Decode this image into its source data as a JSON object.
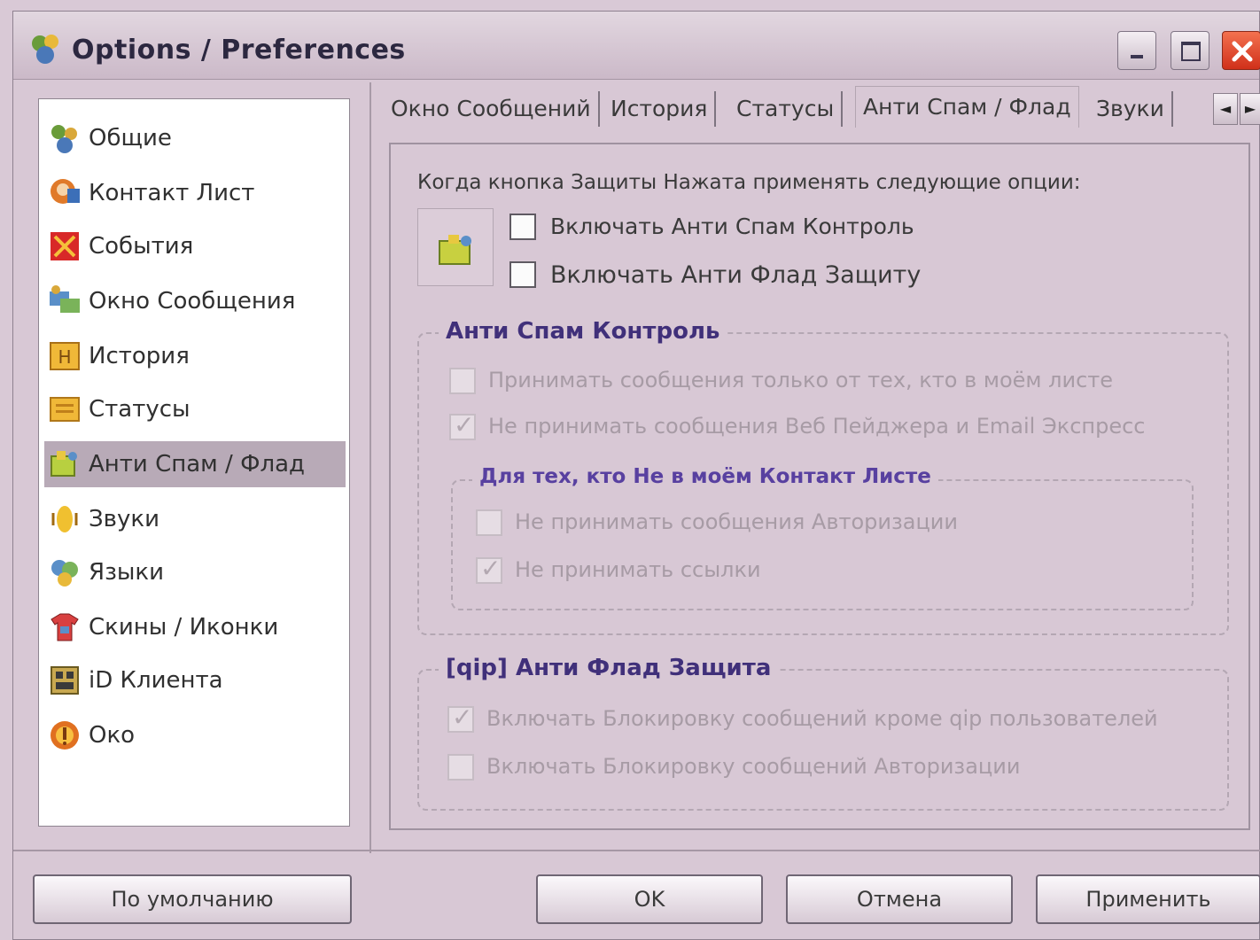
{
  "window": {
    "title": "Options / Preferences",
    "controls": [
      "minimize-icon",
      "maximize-icon",
      "close-icon"
    ]
  },
  "sidebar": {
    "selected_index": 6,
    "items": [
      {
        "label": "Общие",
        "icon": "general-icon"
      },
      {
        "label": "Контакт Лист",
        "icon": "contact-list-icon"
      },
      {
        "label": "События",
        "icon": "events-icon"
      },
      {
        "label": "Окно Сообщения",
        "icon": "message-window-icon"
      },
      {
        "label": "История",
        "icon": "history-icon"
      },
      {
        "label": "Статусы",
        "icon": "statuses-icon"
      },
      {
        "label": "Анти Спам / Флад",
        "icon": "anti-spam-icon"
      },
      {
        "label": "Звуки",
        "icon": "sounds-icon"
      },
      {
        "label": "Языки",
        "icon": "languages-icon"
      },
      {
        "label": "Скины / Иконки",
        "icon": "skins-icon"
      },
      {
        "label": "iD Клиента",
        "icon": "client-id-icon"
      },
      {
        "label": "Око",
        "icon": "eye-icon"
      }
    ]
  },
  "tabs": [
    {
      "label": "Окно Сообщений",
      "active": false
    },
    {
      "label": "История",
      "active": false
    },
    {
      "label": "Статусы",
      "active": false
    },
    {
      "label": "Анти Спам / Флад",
      "active": true
    },
    {
      "label": "Звуки",
      "active": false
    }
  ],
  "tab_scroll": {
    "left": "◄",
    "right": "►"
  },
  "main": {
    "prompt": "Когда кнопка Защиты Нажата применять следующие опции:",
    "shield_options": [
      {
        "label": "Включать Анти Спам Контроль",
        "checked": false
      },
      {
        "label": "Включать Анти Флад Защиту",
        "checked": false
      }
    ],
    "antispam": {
      "title": "Анти Спам Контроль",
      "options": [
        {
          "label": "Принимать сообщения только от тех, кто в моём листе",
          "checked": false,
          "enabled": false
        },
        {
          "label": "Не принимать сообщения Веб Пейджера и Email Экспресс",
          "checked": true,
          "enabled": false
        }
      ],
      "not_in_list": {
        "title": "Для тех, кто Не в моём Контакт Листе",
        "options": [
          {
            "label": "Не принимать сообщения Авторизации",
            "checked": false,
            "enabled": false
          },
          {
            "label": "Не принимать ссылки",
            "checked": true,
            "enabled": false
          }
        ]
      }
    },
    "antiflood": {
      "title": "[qip] Анти Флад Защита",
      "options": [
        {
          "label": "Включать Блокировку сообщений кроме qip пользователей",
          "checked": true,
          "enabled": false
        },
        {
          "label": "Включать Блокировку сообщений Авторизации",
          "checked": false,
          "enabled": false
        }
      ]
    }
  },
  "footer": {
    "default_label": "По умолчанию",
    "ok_label": "OK",
    "cancel_label": "Отмена",
    "apply_label": "Применить"
  },
  "tick_glyph": "✓"
}
